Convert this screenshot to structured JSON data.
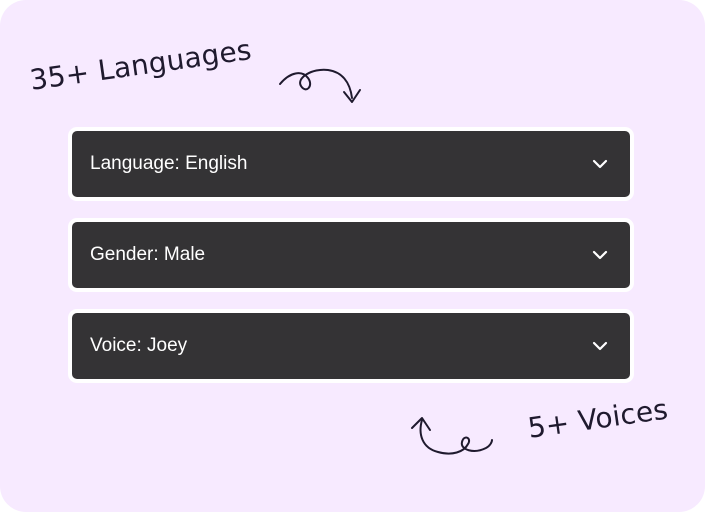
{
  "annotations": {
    "languages": "35+ Languages",
    "voices": "5+ Voices"
  },
  "dropdowns": [
    {
      "label": "Language: English",
      "icon": "chevron-down-icon"
    },
    {
      "label": "Gender: Male",
      "icon": "chevron-down-icon"
    },
    {
      "label": "Voice: Joey",
      "icon": "chevron-down-icon"
    }
  ],
  "colors": {
    "background": "#f7eaff",
    "dropdown": "#343335",
    "dropdown_text": "#ffffff",
    "annotation": "#1f1a2e"
  }
}
